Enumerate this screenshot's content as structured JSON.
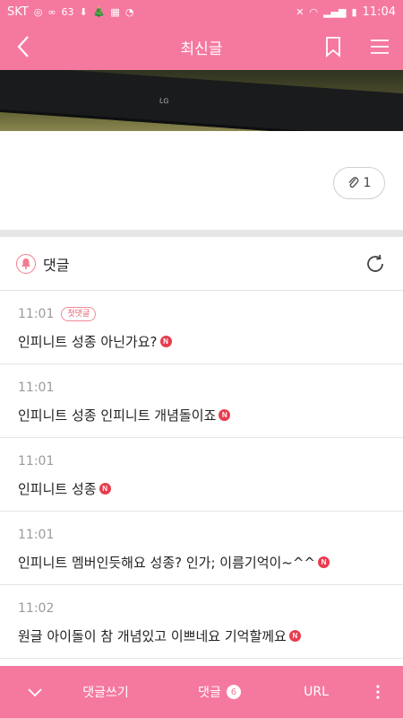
{
  "status_bar": {
    "carrier": "SKT",
    "notif_63": "63",
    "time": "11:04"
  },
  "header": {
    "title": "최신글",
    "icons": [
      "back-icon",
      "bookmark-icon",
      "menu-icon"
    ]
  },
  "photo": {
    "tv_brand": "LG"
  },
  "attachment": {
    "count": "1",
    "icon": "paperclip-icon"
  },
  "comments": {
    "label": "댓글",
    "items": [
      {
        "time": "11:01",
        "badge": "첫댓글",
        "text": "인피니트 성종 아닌가요?",
        "new": "N"
      },
      {
        "time": "11:01",
        "badge": "",
        "text": "인피니트 성종 인피니트 개념돌이죠",
        "new": "N"
      },
      {
        "time": "11:01",
        "badge": "",
        "text": "인피니트 성종",
        "new": "N"
      },
      {
        "time": "11:01",
        "badge": "",
        "text": "인피니트 멤버인듯해요 성종? 인가; 이름기억이~^^",
        "new": "N"
      },
      {
        "time": "11:02",
        "badge": "",
        "text": "원글 아이돌이 참 개념있고 이쁘네요 기억할께요",
        "new": "N"
      }
    ]
  },
  "bottom_bar": {
    "write_label": "댓글쓰기",
    "comments_label": "댓글",
    "comments_count": "6",
    "url_label": "URL"
  },
  "colors": {
    "brand": "#f5799f",
    "new_badge": "#e83c4e",
    "first_badge": "#e85d6f"
  }
}
